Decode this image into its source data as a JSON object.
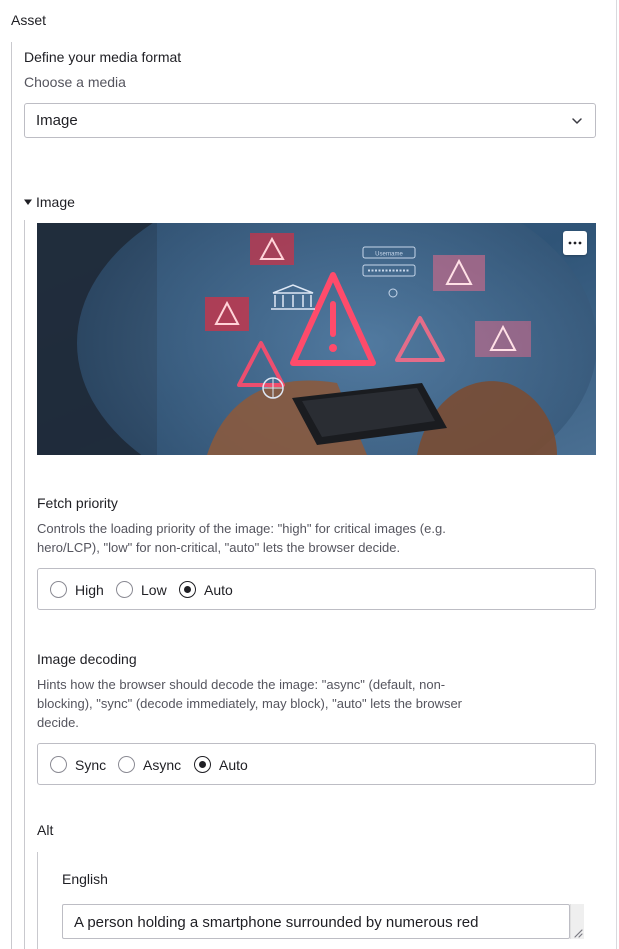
{
  "section": {
    "title": "Asset"
  },
  "media_format": {
    "heading": "Define your media format",
    "subheading": "Choose a media",
    "selected": "Image"
  },
  "image_panel": {
    "label": "Image",
    "more_icon": "more-horizontal-icon"
  },
  "fetch_priority": {
    "label": "Fetch priority",
    "help_line1": "Controls the loading priority of the image: \"high\" for critical images (e.g.",
    "help_line2": "hero/LCP), \"low\" for non-critical, \"auto\" lets the browser decide.",
    "options": [
      "High",
      "Low",
      "Auto"
    ],
    "selected": "Auto"
  },
  "image_decoding": {
    "label": "Image decoding",
    "help_line1": "Hints how the browser should decode the image: \"async\" (default, non-",
    "help_line2": "blocking), \"sync\" (decode immediately, may block), \"auto\" lets the browser",
    "help_line3": "decide.",
    "options": [
      "Sync",
      "Async",
      "Auto"
    ],
    "selected": "Auto"
  },
  "alt": {
    "label": "Alt",
    "language": "English",
    "value": "A person holding a smartphone surrounded by numerous red"
  },
  "image_text": {
    "username": "Username"
  }
}
